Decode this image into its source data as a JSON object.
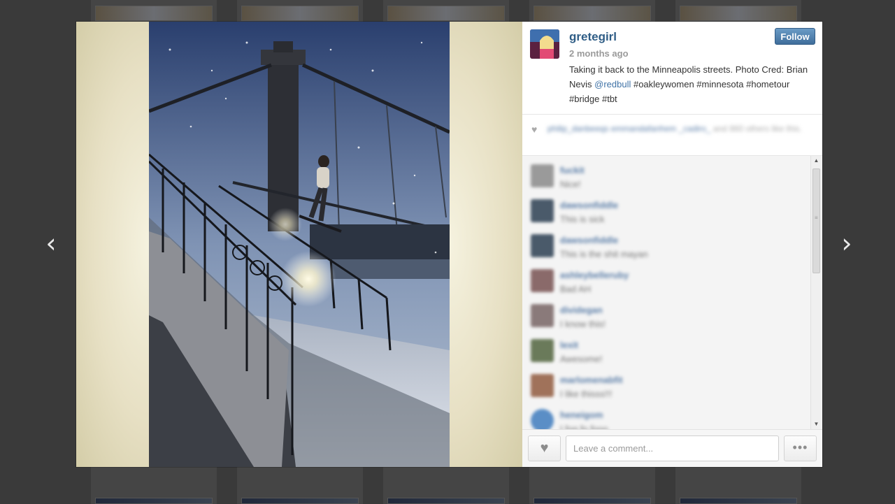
{
  "post": {
    "username": "gretegirl",
    "time": "2 months ago",
    "follow_label": "Follow",
    "caption_before": "Taking it back to the Minneapolis streets. Photo Cred: Brian Nevis ",
    "caption_mention": "@redbull",
    "caption_after": " #oakleywomen #minnesota #hometour #bridge #tbt"
  },
  "likes": {
    "heart_icon": "heart-icon",
    "names": "philip_danbeeqs emmandafanhem _cadiro_",
    "rest": " and 860 others like this."
  },
  "comments": [
    {
      "user": "fuckit",
      "text": "Nice!",
      "avatar_color": "#9a9a9a"
    },
    {
      "user": "dawsonfiddle",
      "text": "This is sick",
      "avatar_color": "#4a5a6a"
    },
    {
      "user": "dawsonfiddle",
      "text": "This is the shit mayan",
      "avatar_color": "#4a5a6a"
    },
    {
      "user": "ashleybelleruby",
      "text": "Bad AH",
      "avatar_color": "#8a6a6a"
    },
    {
      "user": "dividegan",
      "text": "I know this!",
      "avatar_color": "#8a7a7a"
    },
    {
      "user": "lexit",
      "text": "Awesome!",
      "avatar_color": "#6a7a5a"
    },
    {
      "user": "marlomenabfit",
      "text": "I like thisss!!!",
      "avatar_color": "#a0725a"
    },
    {
      "user": "heneigom",
      "text": "I fog fo fooo",
      "avatar_color": "#5a8ec6"
    }
  ],
  "footer": {
    "comment_placeholder": "Leave a comment...",
    "heart_glyph": "♥",
    "more_glyph": "•••"
  },
  "nav": {
    "prev_glyph": "‹",
    "next_glyph": "›"
  }
}
